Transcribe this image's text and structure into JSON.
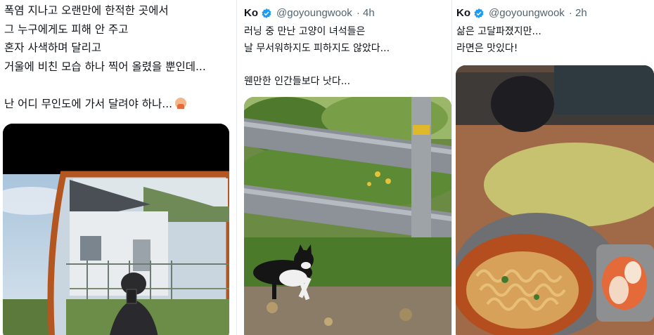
{
  "tweet1": {
    "lines": [
      "폭염 지나고 오랜만에 한적한 곳에서",
      "그 누구에게도 피해 안 주고",
      "혼자 사색하며 달리고",
      "거울에 비친 모습 하나 찍어 올렸을 뿐인데...",
      "",
      "난 어디 무인도에 가서 달려야 하나..."
    ],
    "emoji": "person-shrugging-emoji"
  },
  "tweet2": {
    "author": "Ko",
    "handle": "@goyoungwook",
    "time": "· 4h",
    "lines": [
      "러닝 중 만난 고양이 녀석들은",
      "날 무서워하지도 피하지도 않았다...",
      "",
      "웬만한 인간들보다 낫다..."
    ]
  },
  "tweet3": {
    "author": "Ko",
    "handle": "@goyoungwook",
    "time": "· 2h",
    "lines": [
      "삶은 고달파졌지만...",
      "라면은 맛있다!"
    ]
  },
  "colors": {
    "verified": "#1d9bf0",
    "handle": "#536471",
    "text": "#0f1419",
    "divider": "#e6e9ec"
  }
}
